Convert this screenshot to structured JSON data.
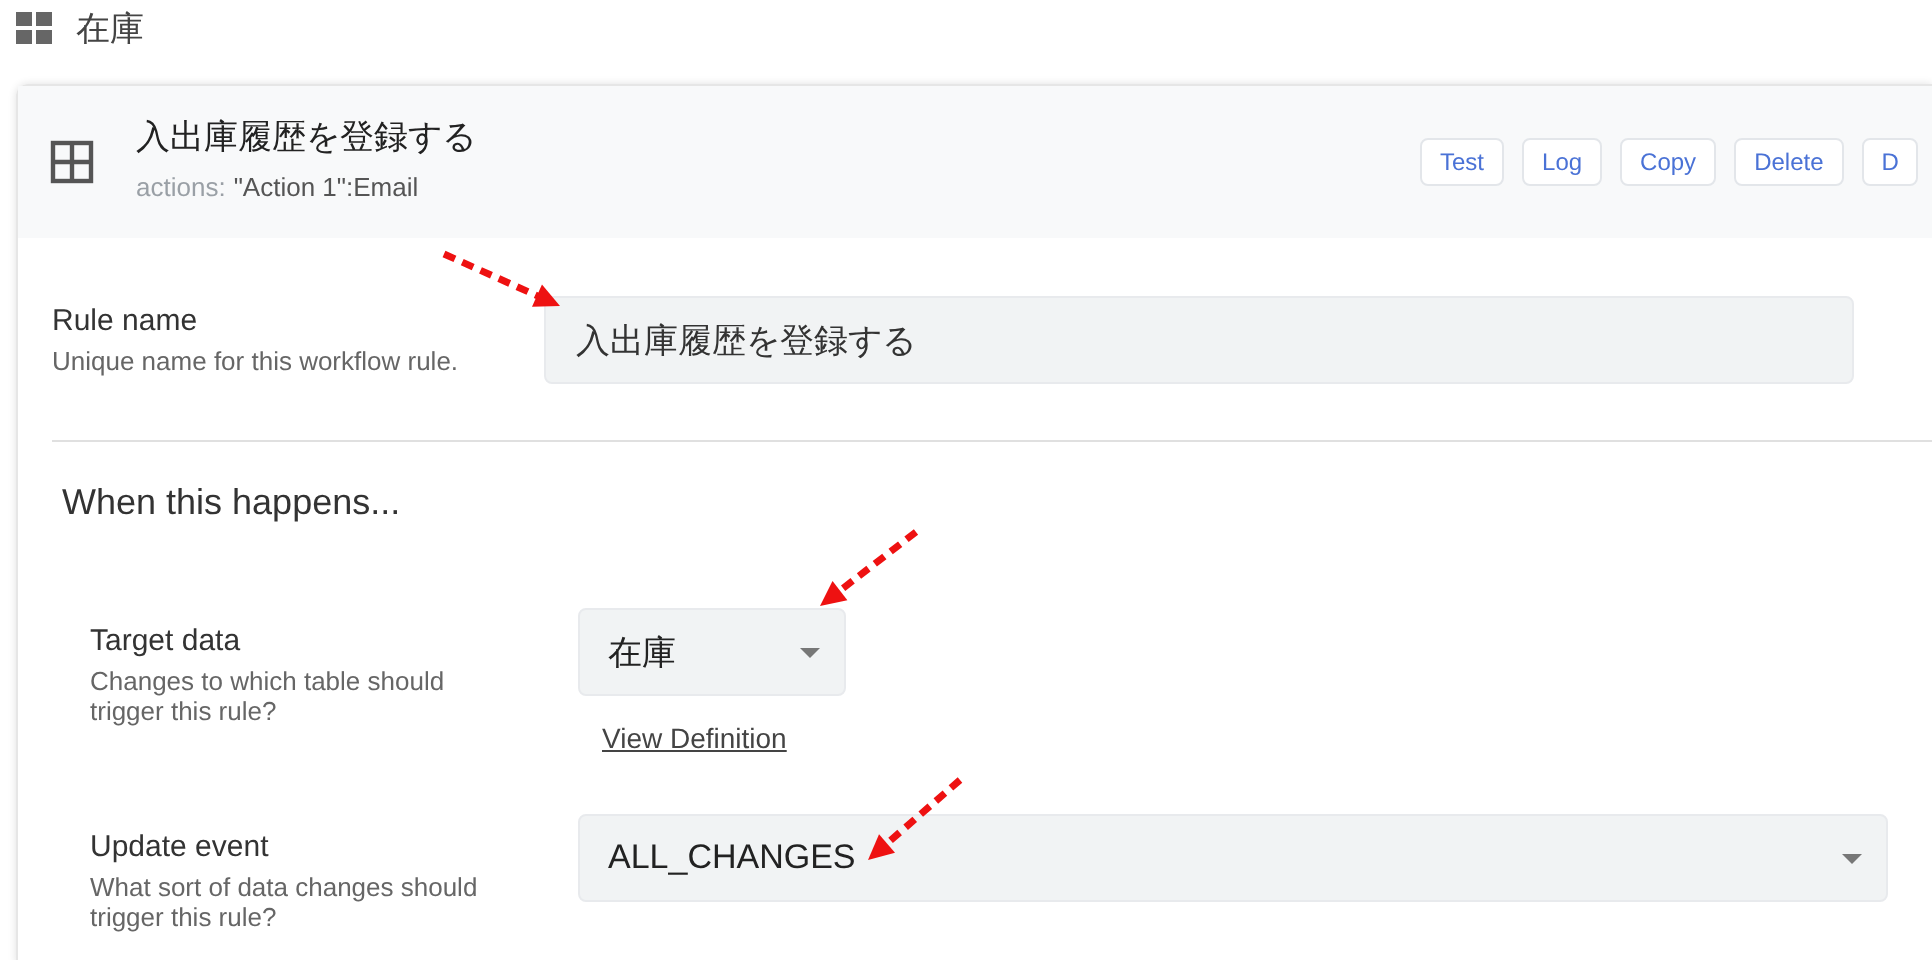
{
  "page": {
    "title": "在庫"
  },
  "rule_card": {
    "title": "入出庫履歴を登録する",
    "subtitle_label": "actions:",
    "subtitle_value": "\"Action 1\":Email",
    "buttons": [
      "Test",
      "Log",
      "Copy",
      "Delete",
      "D"
    ]
  },
  "rule_name": {
    "label": "Rule name",
    "hint": "Unique name for this workflow rule.",
    "value": "入出庫履歴を登録する"
  },
  "section": {
    "title": "When this happens..."
  },
  "fields": [
    {
      "label": "Target data",
      "hint": "Changes to which table should trigger this rule?",
      "value": "在庫",
      "kind": "short",
      "link": "View Definition"
    },
    {
      "label": "Update event",
      "hint": "What sort of data changes should trigger this rule?",
      "value": "ALL_CHANGES",
      "kind": "wide"
    }
  ]
}
